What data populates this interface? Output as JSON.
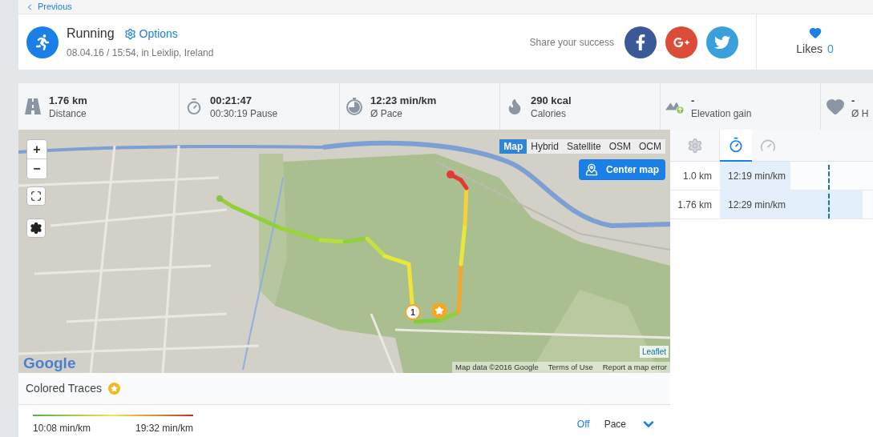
{
  "nav": {
    "back_label": "Previous"
  },
  "activity": {
    "title": "Running",
    "options_label": "Options",
    "subtitle": "08.04.16 / 15:54, in Leixlip, Ireland"
  },
  "share": {
    "label": "Share your success",
    "buttons": [
      {
        "kind": "facebook"
      },
      {
        "kind": "google"
      },
      {
        "kind": "twitter"
      }
    ]
  },
  "likes": {
    "label": "Likes",
    "count": "0"
  },
  "stats": [
    {
      "kind": "distance",
      "value": "1.76 km",
      "label": "Distance"
    },
    {
      "kind": "duration",
      "value": "00:21:47",
      "label": "00:30:19 Pause"
    },
    {
      "kind": "pace",
      "value": "12:23 min/km",
      "label": "Ø Pace"
    },
    {
      "kind": "calories",
      "value": "290 kcal",
      "label": "Calories"
    },
    {
      "kind": "elevation",
      "value": "-",
      "label": "Elevation gain"
    },
    {
      "kind": "heart",
      "value": "-",
      "label": "Ø H"
    }
  ],
  "map": {
    "zoom_in": "+",
    "zoom_out": "−",
    "layers": [
      {
        "label": "Map",
        "selected": true
      },
      {
        "label": "Hybrid",
        "selected": false
      },
      {
        "label": "Satellite",
        "selected": false
      },
      {
        "label": "OSM",
        "selected": false
      },
      {
        "label": "OCM",
        "selected": false
      }
    ],
    "center_button": "Center map",
    "lap_marker": "1",
    "logo": "Google",
    "leaflet_link": "Leaflet",
    "attribution": [
      "Map data ©2016 Google",
      "Terms of Use",
      "Report a map error"
    ]
  },
  "splits": {
    "tabs": [
      {
        "kind": "settings",
        "selected": false
      },
      {
        "kind": "stopwatch",
        "selected": true
      },
      {
        "kind": "speed",
        "selected": false
      }
    ],
    "rows": [
      {
        "distance": "1.0 km",
        "pace": "12:19 min/km",
        "level": 0.46
      },
      {
        "distance": "1.76 km",
        "pace": "12:29 min/km",
        "level": 0.93
      }
    ]
  },
  "colored_traces": {
    "title": "Colored Traces",
    "legend_min": "10:08 min/km",
    "legend_max": "19:32 min/km",
    "toggle_label": "Off",
    "metric": "Pace"
  }
}
